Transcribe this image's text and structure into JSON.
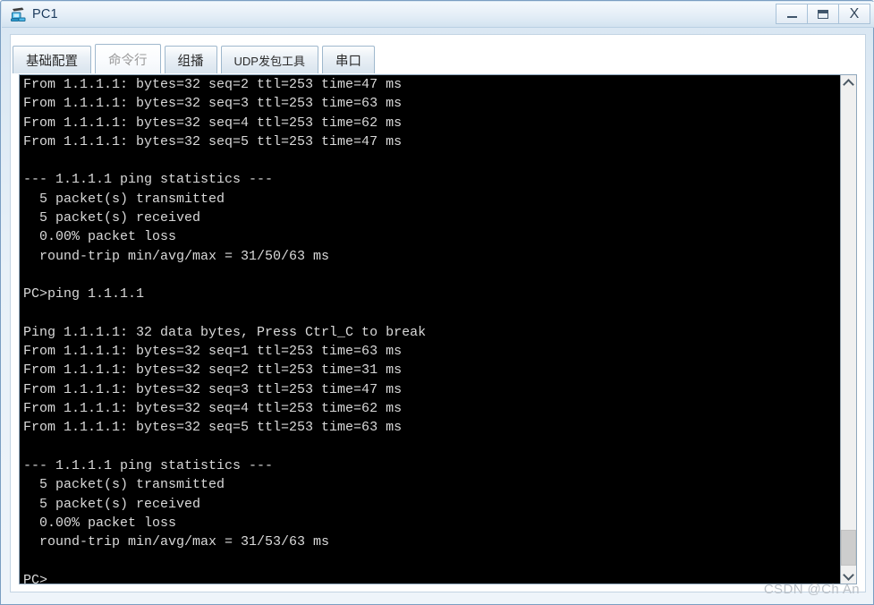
{
  "window": {
    "title": "PC1",
    "icon": "pc-device-icon",
    "controls": {
      "minimize_label": "–",
      "maximize_label": "□",
      "close_label": "X"
    }
  },
  "tabs": [
    {
      "label": "基础配置",
      "name": "tab-basic-config",
      "selected": false,
      "small": false
    },
    {
      "label": "命令行",
      "name": "tab-command-line",
      "selected": true,
      "small": false
    },
    {
      "label": "组播",
      "name": "tab-multicast",
      "selected": false,
      "small": false
    },
    {
      "label": "UDP发包工具",
      "name": "tab-udp-tool",
      "selected": false,
      "small": true
    },
    {
      "label": "串口",
      "name": "tab-serial-port",
      "selected": false,
      "small": false
    }
  ],
  "terminal": {
    "lines": [
      "From 1.1.1.1: bytes=32 seq=2 ttl=253 time=47 ms",
      "From 1.1.1.1: bytes=32 seq=3 ttl=253 time=63 ms",
      "From 1.1.1.1: bytes=32 seq=4 ttl=253 time=62 ms",
      "From 1.1.1.1: bytes=32 seq=5 ttl=253 time=47 ms",
      "",
      "--- 1.1.1.1 ping statistics ---",
      "  5 packet(s) transmitted",
      "  5 packet(s) received",
      "  0.00% packet loss",
      "  round-trip min/avg/max = 31/50/63 ms",
      "",
      "PC>ping 1.1.1.1",
      "",
      "Ping 1.1.1.1: 32 data bytes, Press Ctrl_C to break",
      "From 1.1.1.1: bytes=32 seq=1 ttl=253 time=63 ms",
      "From 1.1.1.1: bytes=32 seq=2 ttl=253 time=31 ms",
      "From 1.1.1.1: bytes=32 seq=3 ttl=253 time=47 ms",
      "From 1.1.1.1: bytes=32 seq=4 ttl=253 time=62 ms",
      "From 1.1.1.1: bytes=32 seq=5 ttl=253 time=63 ms",
      "",
      "--- 1.1.1.1 ping statistics ---",
      "  5 packet(s) transmitted",
      "  5 packet(s) received",
      "  0.00% packet loss",
      "  round-trip min/avg/max = 31/53/63 ms",
      "",
      "PC>"
    ],
    "foreground_color": "#d9d9d9",
    "background_color": "#000000"
  },
  "scrollbar": {
    "up_arrow": "chevron-up",
    "down_arrow": "chevron-down",
    "thumb_color": "#cdcdcd"
  },
  "watermark": {
    "text": "CSDN @Ch An"
  }
}
